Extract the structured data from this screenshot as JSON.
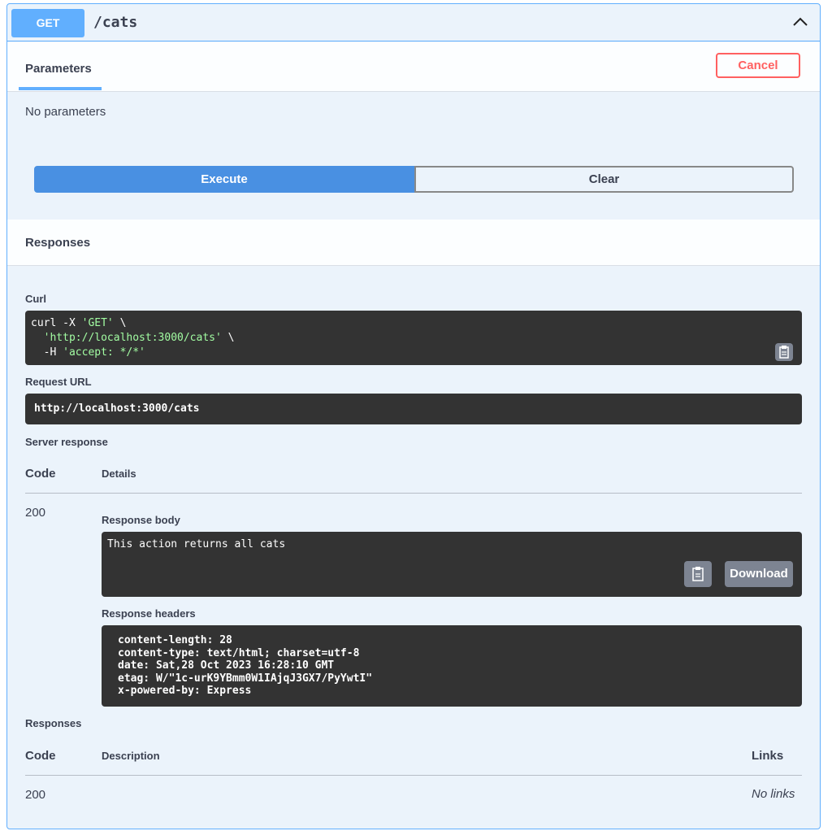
{
  "operation": {
    "method": "GET",
    "path": "/cats",
    "collapse_icon": "chevron-up-icon"
  },
  "parameters": {
    "tab_label": "Parameters",
    "cancel_label": "Cancel",
    "empty_text": "No parameters"
  },
  "actions": {
    "execute_label": "Execute",
    "clear_label": "Clear"
  },
  "responses_section": {
    "title": "Responses"
  },
  "curl": {
    "label": "Curl",
    "line1_prefix": "curl -X ",
    "line1_method": "'GET'",
    "line1_suffix": " \\",
    "line2_url": "'http://localhost:3000/cats'",
    "line2_suffix": " \\",
    "line3_prefix": "-H ",
    "line3_header": "'accept: */*'",
    "copy_icon": "clipboard-icon"
  },
  "request_url": {
    "label": "Request URL",
    "value": "http://localhost:3000/cats"
  },
  "server_response": {
    "label": "Server response",
    "col_code": "Code",
    "col_details": "Details",
    "code": "200",
    "body_label": "Response body",
    "body": "This action returns all cats",
    "download_label": "Download",
    "headers_label": "Response headers",
    "headers": [
      "content-length: 28",
      "content-type: text/html; charset=utf-8",
      "date: Sat,28 Oct 2023 16:28:10 GMT",
      "etag: W/\"1c-urK9YBmm0W1IAjqJ3GX7/PyYwtI\"",
      "x-powered-by: Express"
    ]
  },
  "documented_responses": {
    "label": "Responses",
    "col_code": "Code",
    "col_description": "Description",
    "col_links": "Links",
    "code": "200",
    "links_value": "No links"
  },
  "colors": {
    "get_accent": "#61affe",
    "execute_blue": "#4990e2",
    "cancel_red": "#ff6060",
    "code_bg": "#333333",
    "string_green": "#a2fca2"
  }
}
